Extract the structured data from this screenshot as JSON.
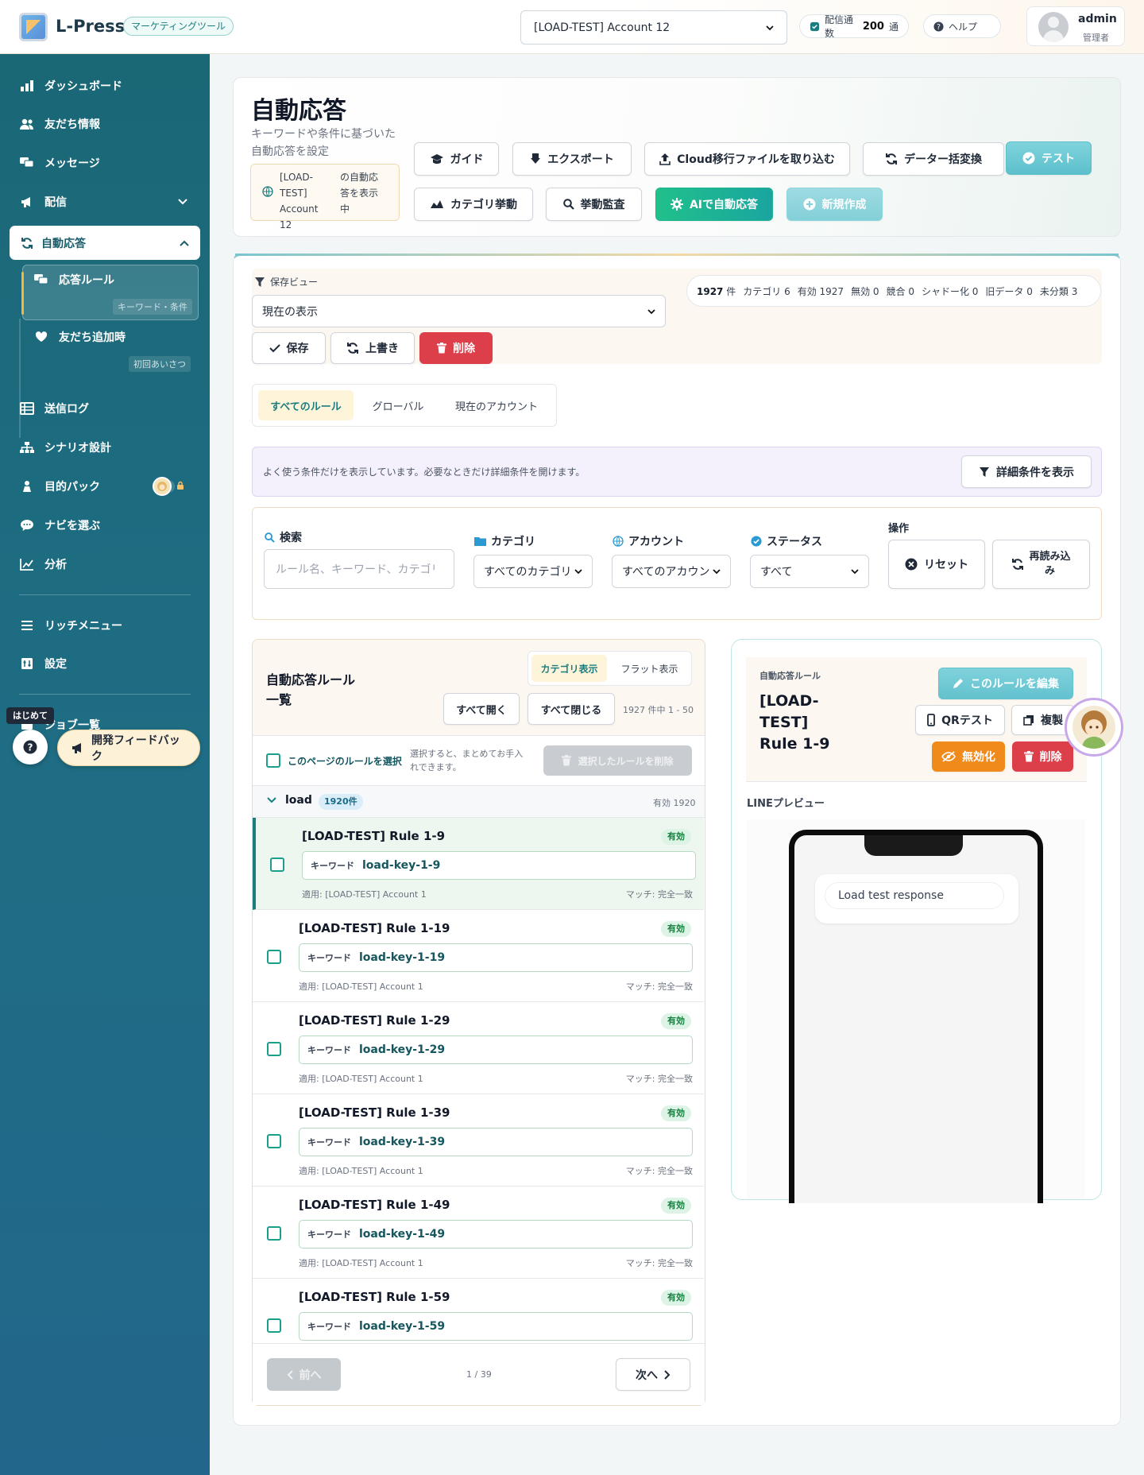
{
  "header": {
    "app_name": "L-Press",
    "app_badge": "マーケティングツール",
    "account_select": "[LOAD-TEST] Account 12",
    "delivery_label": "配信通数",
    "delivery_count": "200",
    "delivery_unit": "通",
    "help_label": "ヘルプ",
    "user_name": "admin",
    "user_role": "管理者"
  },
  "sidebar": {
    "items": [
      {
        "label": "ダッシュボード",
        "icon": "bar-chart-icon"
      },
      {
        "label": "友だち情報",
        "icon": "users-icon"
      },
      {
        "label": "メッセージ",
        "icon": "chat-icon"
      },
      {
        "label": "配信",
        "icon": "megaphone-icon"
      },
      {
        "label": "自動応答",
        "icon": "sync-icon"
      },
      {
        "label": "送信ログ",
        "icon": "list-icon"
      },
      {
        "label": "シナリオ設計",
        "icon": "sitemap-icon"
      },
      {
        "label": "目的パック",
        "icon": "person-icon"
      },
      {
        "label": "ナビを選ぶ",
        "icon": "speech-icon"
      },
      {
        "label": "分析",
        "icon": "chart-line-icon"
      },
      {
        "label": "リッチメニュー",
        "icon": "menu-icon"
      },
      {
        "label": "設定",
        "icon": "settings-icon"
      },
      {
        "label": "ジョブ一覧",
        "icon": "job-icon"
      }
    ],
    "sub_items": [
      {
        "label": "応答ルール",
        "hint": "キーワード・条件"
      },
      {
        "label": "友だち追加時",
        "hint": "初回あいさつ"
      }
    ],
    "help_tag": "はじめて",
    "feedback_label": "開発フィードバック"
  },
  "page": {
    "title": "自動応答",
    "subtitle_line1": "キーワードや条件に基づいた",
    "subtitle_line2": "自動応答を設定",
    "scope_account": "[LOAD-TEST] Account 12",
    "scope_suffix": "の自動応答を表示中",
    "buttons": {
      "guide": "ガイド",
      "export": "エクスポート",
      "import_cloud": "Cloud移行ファイルを取り込む",
      "bulk_convert": "データー括変換",
      "test": "テスト",
      "category_behavior": "カテゴリ挙動",
      "behavior_monitor": "挙動監査",
      "ai_reply": "AIで自動応答",
      "create_new": "新規作成"
    }
  },
  "saved_view": {
    "label": "保存ビュー",
    "selected": "現在の表示",
    "save": "保存",
    "overwrite": "上書き",
    "delete": "削除"
  },
  "stats": {
    "total": "1927",
    "total_unit": "件",
    "category": "カテゴリ 6",
    "active": "有効 1927",
    "inactive": "無効 0",
    "conflict": "競合 0",
    "shadowed": "シャドー化 0",
    "old_data": "旧データ 0",
    "uncategorized": "未分類 3"
  },
  "scope_tabs": [
    {
      "label": "すべてのルール",
      "active": true
    },
    {
      "label": "グローバル",
      "active": false
    },
    {
      "label": "現在のアカウント",
      "active": false
    }
  ],
  "filter_hint": {
    "text": "よく使う条件だけを表示しています。必要なときだけ詳細条件を開けます。",
    "button": "詳細条件を表示"
  },
  "filters": {
    "search_label": "検索",
    "search_placeholder": "ルール名、キーワード、カテゴリ",
    "category_label": "カテゴリ",
    "category_value": "すべてのカテゴリ",
    "account_label": "アカウント",
    "account_value": "すべてのアカウント",
    "status_label": "ステータス",
    "status_value": "すべて",
    "ops_label": "操作",
    "reset": "リセット",
    "reload_line1": "再読み込",
    "reload_line2": "み"
  },
  "rule_list": {
    "title_line1": "自動応答ルール",
    "title_line2": "一覧",
    "view_category": "カテゴリ表示",
    "view_flat": "フラット表示",
    "expand_all": "すべて開く",
    "collapse_all": "すべて閉じる",
    "range": "1927 件中 1 - 50",
    "select_page": "このページのルールを選択",
    "select_hint_line1": "選択すると、まとめてお手入",
    "select_hint_line2": "れできます。",
    "delete_selected": "選択したルールを削除",
    "group_name": "load",
    "group_count": "1920件",
    "group_active": "有効 1920",
    "kw_label": "キーワード",
    "rows": [
      {
        "title": "[LOAD-TEST] Rule 1-9",
        "status": "有効",
        "keyword": "load-key-1-9",
        "applies": "適用: [LOAD-TEST] Account 1",
        "match": "マッチ: 完全一致"
      },
      {
        "title": "[LOAD-TEST] Rule 1-19",
        "status": "有効",
        "keyword": "load-key-1-19",
        "applies": "適用: [LOAD-TEST] Account 1",
        "match": "マッチ: 完全一致"
      },
      {
        "title": "[LOAD-TEST] Rule 1-29",
        "status": "有効",
        "keyword": "load-key-1-29",
        "applies": "適用: [LOAD-TEST] Account 1",
        "match": "マッチ: 完全一致"
      },
      {
        "title": "[LOAD-TEST] Rule 1-39",
        "status": "有効",
        "keyword": "load-key-1-39",
        "applies": "適用: [LOAD-TEST] Account 1",
        "match": "マッチ: 完全一致"
      },
      {
        "title": "[LOAD-TEST] Rule 1-49",
        "status": "有効",
        "keyword": "load-key-1-49",
        "applies": "適用: [LOAD-TEST] Account 1",
        "match": "マッチ: 完全一致"
      },
      {
        "title": "[LOAD-TEST] Rule 1-59",
        "status": "有効",
        "keyword": "load-key-1-59",
        "applies": "",
        "match": ""
      }
    ],
    "prev": "前へ",
    "next": "次へ",
    "page": "1 / 39"
  },
  "detail": {
    "kicker": "自動応答ルール",
    "title_line1": "[LOAD-",
    "title_line2": "TEST]",
    "title_line3": "Rule 1-9",
    "edit": "このルールを編集",
    "qr_test": "QRテスト",
    "duplicate": "複製",
    "disable": "無効化",
    "delete": "削除",
    "preview_label": "LINEプレビュー",
    "preview_message": "Load test response"
  },
  "colors": {
    "primary": "#1b7d7f",
    "sidebar": "#1a6876",
    "accent": "#f5b73b",
    "danger": "#dc3f4a",
    "success": "#1fb987",
    "warning": "#f08a1a"
  }
}
